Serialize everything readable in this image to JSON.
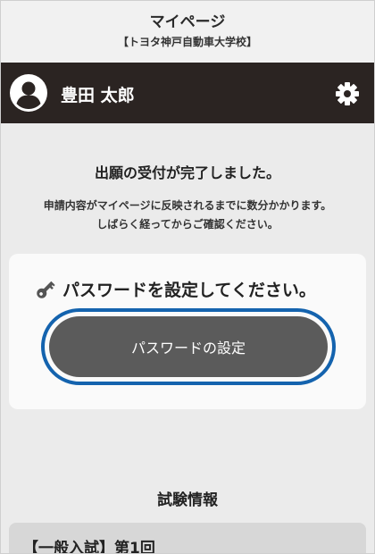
{
  "header": {
    "title": "マイページ",
    "school": "【トヨタ神戸自動車大学校】"
  },
  "user": {
    "name": "豊田 太郎",
    "avatar_icon": "user-avatar-icon",
    "settings_icon": "gear-icon"
  },
  "notice": {
    "title": "出願の受付が完了しました。",
    "line1": "申請内容がマイページに反映されるまでに数分かかります。",
    "line2": "しばらく経ってからご確認ください。"
  },
  "password_card": {
    "icon": "key-icon",
    "heading": "パスワードを設定してください。",
    "button_label": "パスワードの設定"
  },
  "exam": {
    "section_title": "試験情報",
    "first_item": "【一般入試】第1回"
  },
  "colors": {
    "userbar_bg": "#2b2422",
    "button_bg": "#5b5b5b",
    "focus_ring": "#1463ae",
    "page_bg": "#ebebeb"
  }
}
